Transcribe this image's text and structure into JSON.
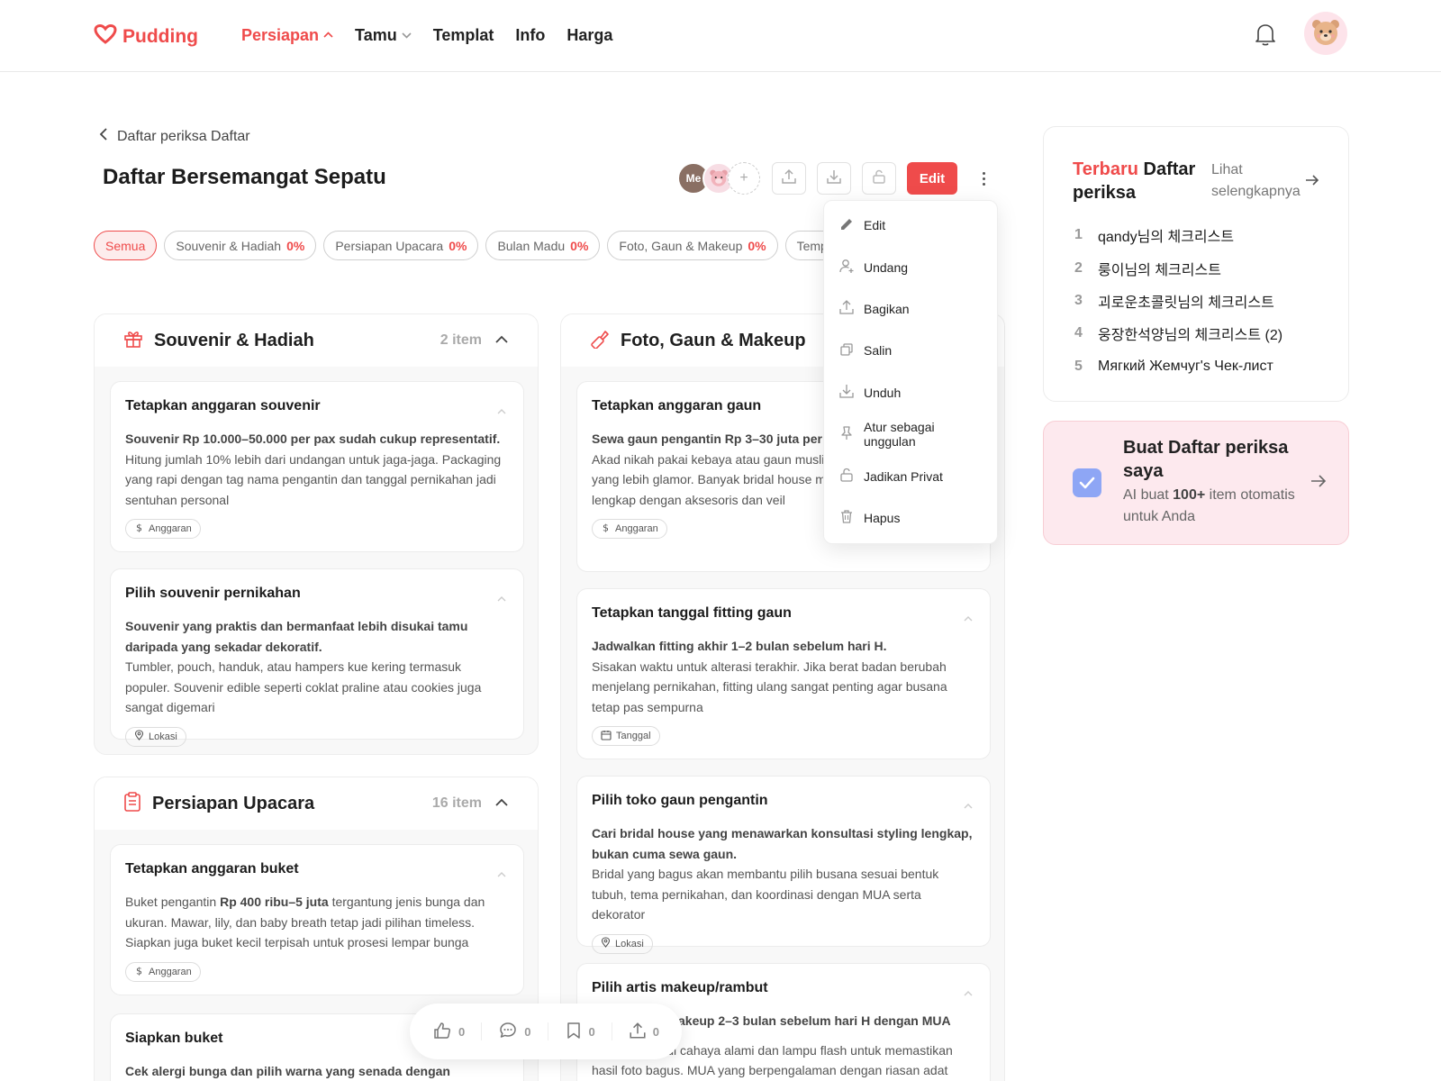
{
  "brand": {
    "name": "Pudding",
    "accent": "#ef4b4b"
  },
  "nav": [
    {
      "label": "Persiapan",
      "chevron": "up"
    },
    {
      "label": "Tamu",
      "chevron": "down"
    },
    {
      "label": "Templat"
    },
    {
      "label": "Info"
    },
    {
      "label": "Harga"
    }
  ],
  "breadcrumb": "Daftar periksa Daftar",
  "page_title": "Daftar Bersemangat Sepatu",
  "members": {
    "me_label": "Me",
    "add_label": "+"
  },
  "toolbar": {
    "edit_label": "Edit"
  },
  "chips": [
    {
      "label": "Semua",
      "pct": ""
    },
    {
      "label": "Souvenir & Hadiah",
      "pct": "0%"
    },
    {
      "label": "Persiapan Upacara",
      "pct": "0%"
    },
    {
      "label": "Bulan Madu",
      "pct": "0%"
    },
    {
      "label": "Foto, Gaun & Makeup",
      "pct": "0%"
    },
    {
      "label": "Tempat Pernikahan",
      "pct": "0%"
    }
  ],
  "sections": {
    "souvenir": {
      "title": "Souvenir & Hadiah",
      "count": "2 item",
      "cards": [
        {
          "title": "Tetapkan anggaran souvenir",
          "lead": "Souvenir Rp 10.000–50.000 per pax sudah cukup representatif.",
          "body": "Hitung jumlah 10% lebih dari undangan untuk jaga-jaga. Packaging yang rapi dengan tag nama pengantin dan tanggal pernikahan jadi sentuhan personal",
          "tag": "Anggaran"
        },
        {
          "title": "Pilih souvenir pernikahan",
          "lead": "Souvenir yang praktis dan bermanfaat lebih disukai tamu daripada yang sekadar dekoratif.",
          "body": "Tumbler, pouch, handuk, atau hampers kue kering termasuk populer. Souvenir edible seperti coklat praline atau cookies juga sangat digemari",
          "tag": "Lokasi"
        }
      ]
    },
    "ceremony": {
      "title": "Persiapan Upacara",
      "count": "16 item",
      "cards": [
        {
          "title": "Tetapkan anggaran buket",
          "pre": "Buket pengantin ",
          "bold": "Rp 400 ribu–5 juta",
          "post": " tergantung jenis bunga dan ukuran. Mawar, lily, dan baby breath tetap jadi pilihan timeless. Siapkan juga buket kecil terpisah untuk prosesi lempar bunga",
          "tag": "Anggaran"
        },
        {
          "title": "Siapkan buket",
          "lead": "Cek alergi bunga dan pilih warna yang senada dengan"
        }
      ]
    },
    "photo": {
      "title": "Foto, Gaun & Makeup",
      "cards": [
        {
          "title": "Tetapkan anggaran gaun",
          "lead": "Sewa gaun pengantin Rp 3–30 juta per set berbeda.",
          "body": "Akad nikah pakai kebaya atau gaun muslimah, resepsi bisa gaun yang lebih glamor. Banyak bridal house menawarkan paket sewa lengkap dengan aksesoris dan veil",
          "tag": "Anggaran"
        },
        {
          "title": "Tetapkan tanggal fitting gaun",
          "lead": "Jadwalkan fitting akhir 1–2 bulan sebelum hari H.",
          "body": "Sisakan waktu untuk alterasi terakhir. Jika berat badan berubah menjelang pernikahan, fitting ulang sangat penting agar busana tetap pas sempurna",
          "tag": "Tanggal"
        },
        {
          "title": "Pilih toko gaun pengantin",
          "lead": "Cari bridal house yang menawarkan konsultasi styling lengkap, bukan cuma sewa gaun.",
          "body": "Bridal yang bagus akan membantu pilih busana sesuai bentuk tubuh, tema pernikahan, dan koordinasi dengan MUA serta dekorator",
          "tag": "Lokasi"
        },
        {
          "title": "Pilih artis makeup/rambut",
          "lead": "akeup 2–3 bulan sebelum hari H dengan MUA",
          "body": "Test makeup di cahaya alami dan lampu flash untuk memastikan hasil foto bagus. MUA yang berpengalaman dengan riasan adat (paes, Jawa"
        }
      ]
    }
  },
  "menu": [
    {
      "label": "Edit",
      "icon": "pencil-icon"
    },
    {
      "label": "Undang",
      "icon": "add-user-icon"
    },
    {
      "label": "Bagikan",
      "icon": "share-icon"
    },
    {
      "label": "Salin",
      "icon": "copy-icon"
    },
    {
      "label": "Unduh",
      "icon": "download-icon"
    },
    {
      "label": "Atur sebagai unggulan",
      "icon": "pin-icon"
    },
    {
      "label": "Jadikan Privat",
      "icon": "lock-icon"
    },
    {
      "label": "Hapus",
      "icon": "trash-icon"
    }
  ],
  "recent": {
    "title_accent": "Terbaru",
    "title_rest": " Daftar periksa",
    "more": "Lihat selengkapnya",
    "items": [
      {
        "num": "1",
        "label": "qandy님의 체크리스트"
      },
      {
        "num": "2",
        "label": "룽이님의 체크리스트"
      },
      {
        "num": "3",
        "label": "괴로운초콜릿님의 체크리스트"
      },
      {
        "num": "4",
        "label": "웅장한석양님의 체크리스트 (2)"
      },
      {
        "num": "5",
        "label": "Мягкий Жемчуг's Чек-лист"
      }
    ]
  },
  "cta": {
    "title": "Buat Daftar periksa saya",
    "sub_pre": "AI buat ",
    "sub_bold": "100+",
    "sub_post": " item otomatis untuk Anda"
  },
  "actionbar": {
    "likes": "0",
    "comments": "0",
    "bookmarks": "0",
    "shares": "0"
  }
}
